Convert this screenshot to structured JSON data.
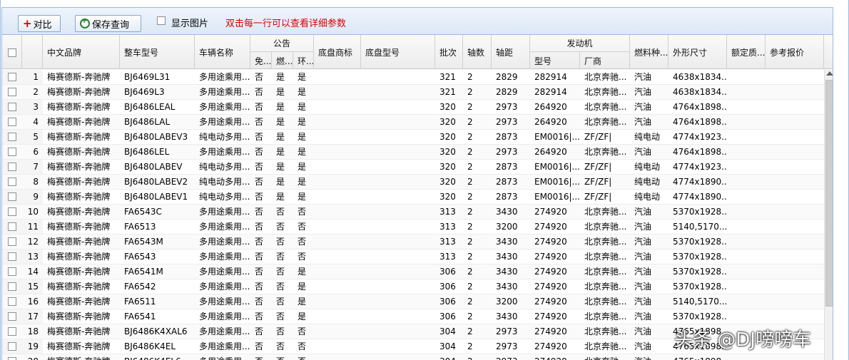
{
  "toolbar": {
    "compare_label": "对比",
    "save_query_label": "保存查询",
    "show_images_label": "显示图片",
    "hint": "双击每一行可以查看详细参数"
  },
  "columns": {
    "brand": "中文品牌",
    "model": "整车型号",
    "name": "车辆名称",
    "notice": "公告",
    "notice_exempt": "免...",
    "notice_fuel": "燃...",
    "notice_env": "环...",
    "chassis_brand": "底盘商标",
    "chassis_model": "底盘型号",
    "batch": "批次",
    "axles": "轴数",
    "wheelbase": "轴距",
    "engine": "发动机",
    "engine_model": "型号",
    "engine_maker": "厂商",
    "fuel": "燃料种...",
    "dimensions": "外形尺寸",
    "rated_mass": "额定质...",
    "price": "参考报价"
  },
  "rows": [
    {
      "n": "1",
      "brand": "梅赛德斯-奔驰牌",
      "model": "BJ6469L31",
      "name": "多用途乘用...",
      "ex": "否",
      "fu": "是",
      "env": "是",
      "batch": "321",
      "axles": "2",
      "wb": "2829",
      "em": "282914",
      "maker": "北京奔驰...",
      "fuel": "汽油",
      "dim": "4638x1834..."
    },
    {
      "n": "2",
      "brand": "梅赛德斯-奔驰牌",
      "model": "BJ6469L3",
      "name": "多用途乘用...",
      "ex": "否",
      "fu": "是",
      "env": "是",
      "batch": "321",
      "axles": "2",
      "wb": "2829",
      "em": "282914",
      "maker": "北京奔驰...",
      "fuel": "汽油",
      "dim": "4638x1834..."
    },
    {
      "n": "3",
      "brand": "梅赛德斯-奔驰牌",
      "model": "BJ6486LEAL",
      "name": "多用途乘用...",
      "ex": "否",
      "fu": "是",
      "env": "是",
      "batch": "320",
      "axles": "2",
      "wb": "2973",
      "em": "264920",
      "maker": "北京奔驰...",
      "fuel": "汽油",
      "dim": "4764x1898..."
    },
    {
      "n": "4",
      "brand": "梅赛德斯-奔驰牌",
      "model": "BJ6486LAL",
      "name": "多用途乘用...",
      "ex": "否",
      "fu": "是",
      "env": "是",
      "batch": "320",
      "axles": "2",
      "wb": "2973",
      "em": "264920",
      "maker": "北京奔驰...",
      "fuel": "汽油",
      "dim": "4764x1898..."
    },
    {
      "n": "5",
      "brand": "梅赛德斯-奔驰牌",
      "model": "BJ6480LABEV3",
      "name": "纯电动多用...",
      "ex": "否",
      "fu": "是",
      "env": "是",
      "batch": "320",
      "axles": "2",
      "wb": "2873",
      "em": "EM0016|...",
      "maker": "ZF/ZF|",
      "fuel": "纯电动",
      "dim": "4774x1923..."
    },
    {
      "n": "6",
      "brand": "梅赛德斯-奔驰牌",
      "model": "BJ6486LEL",
      "name": "多用途乘用...",
      "ex": "否",
      "fu": "是",
      "env": "是",
      "batch": "320",
      "axles": "2",
      "wb": "2973",
      "em": "264920",
      "maker": "北京奔驰...",
      "fuel": "汽油",
      "dim": "4764x1898..."
    },
    {
      "n": "7",
      "brand": "梅赛德斯-奔驰牌",
      "model": "BJ6480LABEV",
      "name": "纯电动多用...",
      "ex": "否",
      "fu": "是",
      "env": "是",
      "batch": "320",
      "axles": "2",
      "wb": "2873",
      "em": "EM0016|...",
      "maker": "ZF/ZF|",
      "fuel": "纯电动",
      "dim": "4774x1923..."
    },
    {
      "n": "8",
      "brand": "梅赛德斯-奔驰牌",
      "model": "BJ6480LABEV2",
      "name": "纯电动多用...",
      "ex": "否",
      "fu": "是",
      "env": "是",
      "batch": "320",
      "axles": "2",
      "wb": "2873",
      "em": "EM0016|...",
      "maker": "ZF/ZF|",
      "fuel": "纯电动",
      "dim": "4774x1890..."
    },
    {
      "n": "9",
      "brand": "梅赛德斯-奔驰牌",
      "model": "BJ6480LABEV1",
      "name": "纯电动多用...",
      "ex": "否",
      "fu": "是",
      "env": "是",
      "batch": "320",
      "axles": "2",
      "wb": "2873",
      "em": "EM0016|...",
      "maker": "ZF/ZF|",
      "fuel": "纯电动",
      "dim": "4774x1890..."
    },
    {
      "n": "10",
      "brand": "梅赛德斯-奔驰牌",
      "model": "FA6543C",
      "name": "多用途乘用...",
      "ex": "否",
      "fu": "否",
      "env": "否",
      "batch": "313",
      "axles": "2",
      "wb": "3430",
      "em": "274920",
      "maker": "北京奔驰...",
      "fuel": "汽油",
      "dim": "5370x1928..."
    },
    {
      "n": "11",
      "brand": "梅赛德斯-奔驰牌",
      "model": "FA6513",
      "name": "多用途乘用...",
      "ex": "否",
      "fu": "否",
      "env": "否",
      "batch": "313",
      "axles": "2",
      "wb": "3200",
      "em": "274920",
      "maker": "北京奔驰...",
      "fuel": "汽油",
      "dim": "5140,5170..."
    },
    {
      "n": "12",
      "brand": "梅赛德斯-奔驰牌",
      "model": "FA6543M",
      "name": "多用途乘用...",
      "ex": "否",
      "fu": "否",
      "env": "否",
      "batch": "313",
      "axles": "2",
      "wb": "3430",
      "em": "274920",
      "maker": "北京奔驰...",
      "fuel": "汽油",
      "dim": "5370x1928..."
    },
    {
      "n": "13",
      "brand": "梅赛德斯-奔驰牌",
      "model": "FA6543",
      "name": "多用途乘用...",
      "ex": "否",
      "fu": "否",
      "env": "否",
      "batch": "313",
      "axles": "2",
      "wb": "3430",
      "em": "274920",
      "maker": "北京奔驰...",
      "fuel": "汽油",
      "dim": "5370x1928..."
    },
    {
      "n": "14",
      "brand": "梅赛德斯-奔驰牌",
      "model": "FA6541M",
      "name": "多用途乘用...",
      "ex": "否",
      "fu": "否",
      "env": "是",
      "batch": "306",
      "axles": "2",
      "wb": "3430",
      "em": "274920",
      "maker": "北京奔驰...",
      "fuel": "汽油",
      "dim": "5370x1928..."
    },
    {
      "n": "15",
      "brand": "梅赛德斯-奔驰牌",
      "model": "FA6542",
      "name": "多用途乘用...",
      "ex": "否",
      "fu": "否",
      "env": "是",
      "batch": "306",
      "axles": "2",
      "wb": "3430",
      "em": "274920",
      "maker": "北京奔驰...",
      "fuel": "汽油",
      "dim": "5370x1928..."
    },
    {
      "n": "16",
      "brand": "梅赛德斯-奔驰牌",
      "model": "FA6511",
      "name": "多用途乘用...",
      "ex": "否",
      "fu": "否",
      "env": "是",
      "batch": "306",
      "axles": "2",
      "wb": "3200",
      "em": "274920",
      "maker": "北京奔驰...",
      "fuel": "汽油",
      "dim": "5140,5170..."
    },
    {
      "n": "17",
      "brand": "梅赛德斯-奔驰牌",
      "model": "FA6541",
      "name": "多用途乘用...",
      "ex": "否",
      "fu": "否",
      "env": "是",
      "batch": "306",
      "axles": "2",
      "wb": "3430",
      "em": "274920",
      "maker": "北京奔驰...",
      "fuel": "汽油",
      "dim": "5370x1928..."
    },
    {
      "n": "18",
      "brand": "梅赛德斯-奔驰牌",
      "model": "BJ6486K4XAL6",
      "name": "多用途乘用...",
      "ex": "否",
      "fu": "否",
      "env": "否",
      "batch": "304",
      "axles": "2",
      "wb": "2973",
      "em": "274920",
      "maker": "北京奔驰...",
      "fuel": "汽油",
      "dim": "4765x1898..."
    },
    {
      "n": "19",
      "brand": "梅赛德斯-奔驰牌",
      "model": "BJ6486K4EL",
      "name": "多用途乘用...",
      "ex": "否",
      "fu": "否",
      "env": "否",
      "batch": "304",
      "axles": "2",
      "wb": "2973",
      "em": "274920",
      "maker": "北京奔驰...",
      "fuel": "汽油",
      "dim": "4765x1898..."
    },
    {
      "n": "20",
      "brand": "梅赛德斯-奔驰牌",
      "model": "BJ6486K4EL6",
      "name": "多用途乘用...",
      "ex": "否",
      "fu": "否",
      "env": "否",
      "batch": "304",
      "axles": "2",
      "wb": "2973",
      "em": "274920",
      "maker": "北京奔驰...",
      "fuel": "汽油",
      "dim": "4765x1898..."
    }
  ],
  "watermark": "头条 @DJ嗙嗙车",
  "colors": {
    "hint_red": "#e00000",
    "border_blue": "#99bbe8"
  }
}
